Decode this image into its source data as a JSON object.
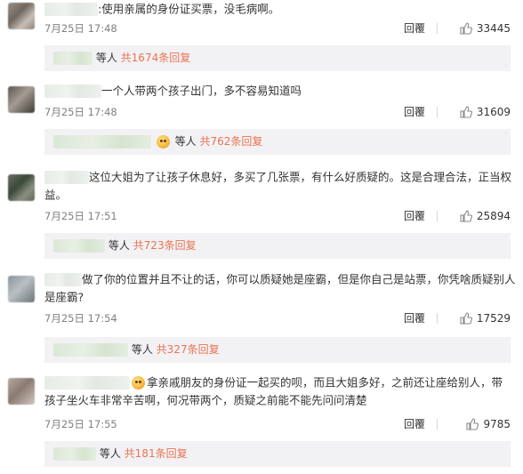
{
  "comments": [
    {
      "lines": [
        ":使用亲属的身份证买票，没毛病啊。"
      ],
      "time": "7月25日 17:48",
      "reply_label": "回覆",
      "likes": "33445",
      "sub": {
        "people_label": "等人",
        "count_label": "共1674条回复"
      }
    },
    {
      "lines": [
        "一个人带两个孩子出门，多不容易知道吗"
      ],
      "time": "7月25日 17:48",
      "reply_label": "回覆",
      "likes": "31609",
      "sub": {
        "people_label": "等人",
        "count_label": "共762条回复"
      }
    },
    {
      "lines": [
        "这位大姐为了让孩子休息好，多买了几张票，有什么好质疑的。这是合理合法，正当权",
        "益。"
      ],
      "time": "7月25日 17:51",
      "reply_label": "回覆",
      "likes": "25894",
      "sub": {
        "people_label": "等人",
        "count_label": "共723条回复"
      }
    },
    {
      "lines": [
        "做了你的位置并且不让的话，你可以质疑她是座霸，但是你自己是站票，你凭啥质疑别人",
        "是座霸?"
      ],
      "time": "7月25日 17:54",
      "reply_label": "回覆",
      "likes": "17529",
      "sub": {
        "people_label": "等人",
        "count_label": "共327条回复"
      }
    },
    {
      "lines": [
        "拿亲戚朋友的身份证一起买的呗，而且大姐多好，之前还让座给别人，带",
        "孩子坐火车非常辛苦啊，何况带两个，质疑之前能不能先问问清楚"
      ],
      "time": "7月25日 17:55",
      "reply_label": "回覆",
      "likes": "9785",
      "sub": {
        "people_label": "等人",
        "count_label": "共181条回复"
      }
    }
  ]
}
